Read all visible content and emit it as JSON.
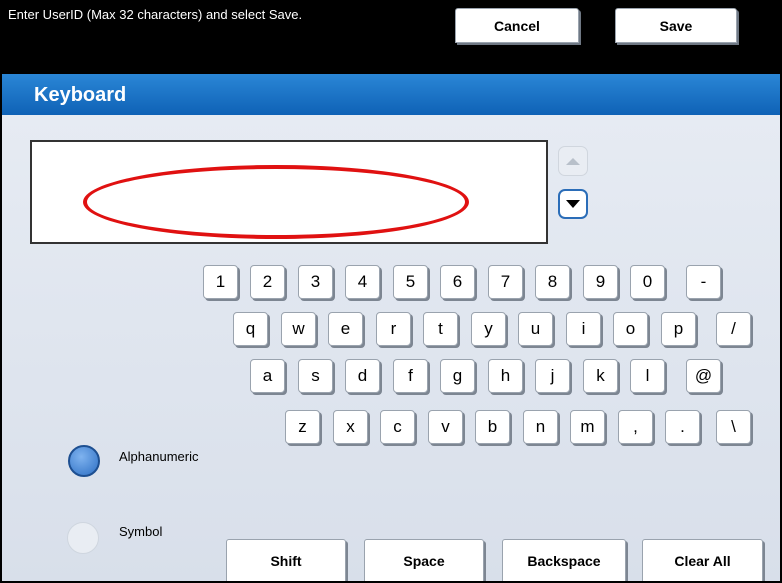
{
  "prompt": "Enter UserID (Max 32 characters) and select Save.",
  "header": {
    "title": "Keyboard",
    "cancel_label": "Cancel",
    "save_label": "Save"
  },
  "entry": {
    "value": ""
  },
  "scroll": {
    "up_icon": "triangle-up-icon",
    "down_icon": "triangle-down-icon"
  },
  "keyboard": {
    "row1": [
      "1",
      "2",
      "3",
      "4",
      "5",
      "6",
      "7",
      "8",
      "9",
      "0",
      "-"
    ],
    "row2": [
      "q",
      "w",
      "e",
      "r",
      "t",
      "y",
      "u",
      "i",
      "o",
      "p",
      "/"
    ],
    "row3": [
      "a",
      "s",
      "d",
      "f",
      "g",
      "h",
      "j",
      "k",
      "l",
      "@"
    ],
    "row4": [
      "z",
      "x",
      "c",
      "v",
      "b",
      "n",
      "m",
      ",",
      ".",
      "\\"
    ]
  },
  "modes": {
    "alphanumeric": "Alphanumeric",
    "symbol": "Symbol",
    "selected": "Alphanumeric"
  },
  "bottom_buttons": {
    "shift": "Shift",
    "space": "Space",
    "backspace": "Backspace",
    "clear_all": "Clear All"
  },
  "colors": {
    "header_blue": "#1a6fc2",
    "highlight_red": "#e01111",
    "background": "#dde4ef"
  }
}
